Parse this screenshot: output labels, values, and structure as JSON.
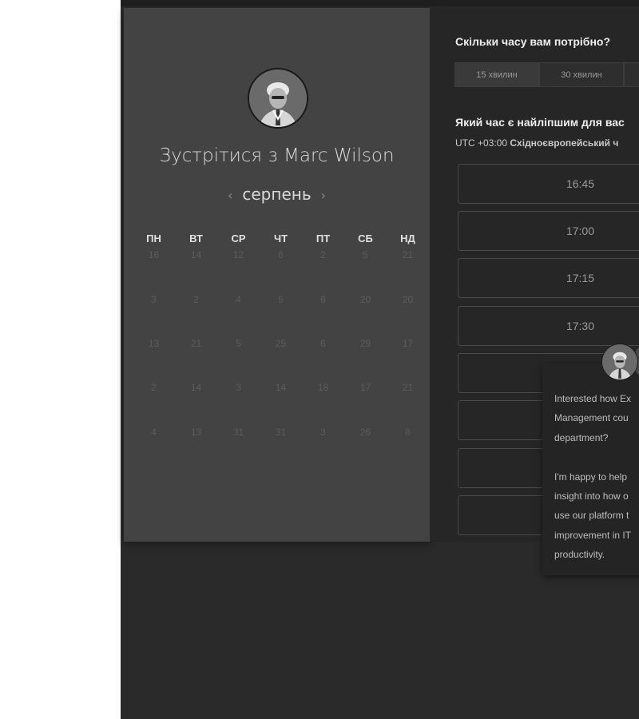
{
  "scheduler": {
    "title": "Зустрітися з Marc Wilson",
    "month": "серпень",
    "weekdays": [
      "ПН",
      "ВТ",
      "СР",
      "ЧТ",
      "ПТ",
      "СБ",
      "НД"
    ],
    "weeks": [
      [
        "16",
        "14",
        "12",
        "6",
        "2",
        "5",
        "21"
      ],
      [
        "3",
        "2",
        "4",
        "5",
        "6",
        "20",
        "20"
      ],
      [
        "13",
        "21",
        "5",
        "25",
        "6",
        "29",
        "17"
      ],
      [
        "2",
        "14",
        "3",
        "14",
        "18",
        "17",
        "21"
      ],
      [
        "4",
        "13",
        "31",
        "31",
        "3",
        "26",
        "8"
      ]
    ]
  },
  "booking": {
    "duration_question": "Скільки часу вам потрібно?",
    "durations": [
      "15 хвилин",
      "30 хвилин"
    ],
    "time_question": "Який час є найліпшим для вас",
    "timezone_offset": "UTC +03:00",
    "timezone_name": "Східноєвропейський ч",
    "slots": [
      "16:45",
      "17:00",
      "17:15",
      "17:30",
      "",
      "",
      "",
      ""
    ]
  },
  "chat": {
    "message": "Interested how Ex\nManagement cou\ndepartment?\n\nI'm happy to help\ninsight into how o\nuse our platform t\nimprovement in IT\nproductivity."
  }
}
